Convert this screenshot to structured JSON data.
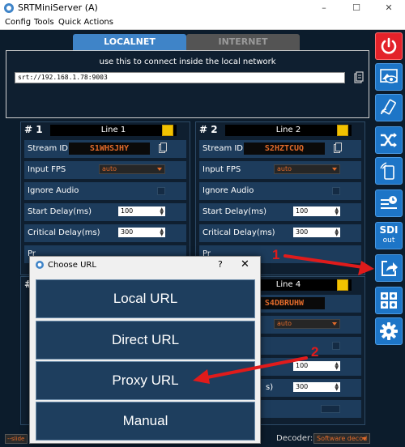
{
  "window": {
    "title": "SRTMiniServer (A)",
    "controls": [
      "–",
      "☐",
      "✕"
    ]
  },
  "menubar": [
    "Config",
    "Tools",
    "Quick Actions"
  ],
  "tabs": [
    {
      "label": "LOCALNET",
      "active": true
    },
    {
      "label": "INTERNET",
      "active": false
    }
  ],
  "connect": {
    "caption": "use this to connect inside the local network",
    "url": "srt://192.168.1.78:9003"
  },
  "lines": [
    {
      "number": "# 1",
      "name": "Line 1",
      "stream_id": "S1WHSJHY",
      "input_fps": "auto",
      "start_delay": "100",
      "critical_delay": "300"
    },
    {
      "number": "# 2",
      "name": "Line 2",
      "stream_id": "S2HZTCUQ",
      "input_fps": "auto",
      "start_delay": "100",
      "critical_delay": "300"
    },
    {
      "number": "#",
      "name": "Line 4",
      "stream_id": "S4DBRUHW",
      "input_fps": "auto",
      "start_delay": "100",
      "critical_delay": "300"
    }
  ],
  "line_labels": {
    "stream_id": "Stream ID",
    "input_fps": "Input FPS",
    "ignore_audio": "Ignore Audio",
    "start_delay": "Start Delay(ms)",
    "critical_delay": "Critical Delay(ms)",
    "cut_critical": "s)",
    "cut_partial": "Pr"
  },
  "rightbar": [
    {
      "icon": "power-icon"
    },
    {
      "icon": "preview-eye-icon"
    },
    {
      "icon": "cast-icon"
    },
    {
      "icon": "shuffle-icon"
    },
    {
      "icon": "phone-signal-icon"
    },
    {
      "icon": "clock-list-icon"
    },
    {
      "icon": "sdi-out-icon",
      "label_top": "SDI",
      "label_bottom": "out"
    },
    {
      "icon": "share-url-icon"
    },
    {
      "icon": "users-grid-icon"
    },
    {
      "icon": "gear-icon"
    }
  ],
  "bottom": {
    "slide_hint": "--slide list",
    "decoder_label": "Decoder:",
    "decoder_value": "Software decod"
  },
  "dialog": {
    "title": "Choose URL",
    "help": "?",
    "close": "✕",
    "buttons": [
      "Local URL",
      "Direct URL",
      "Proxy URL",
      "Manual"
    ]
  },
  "annotations": [
    "1",
    "2"
  ],
  "colors": {
    "accent": "#3f84c8",
    "stream_id_text": "#e06a2a",
    "arrow": "#e01b1b",
    "tool_button": "#1d75c7"
  }
}
